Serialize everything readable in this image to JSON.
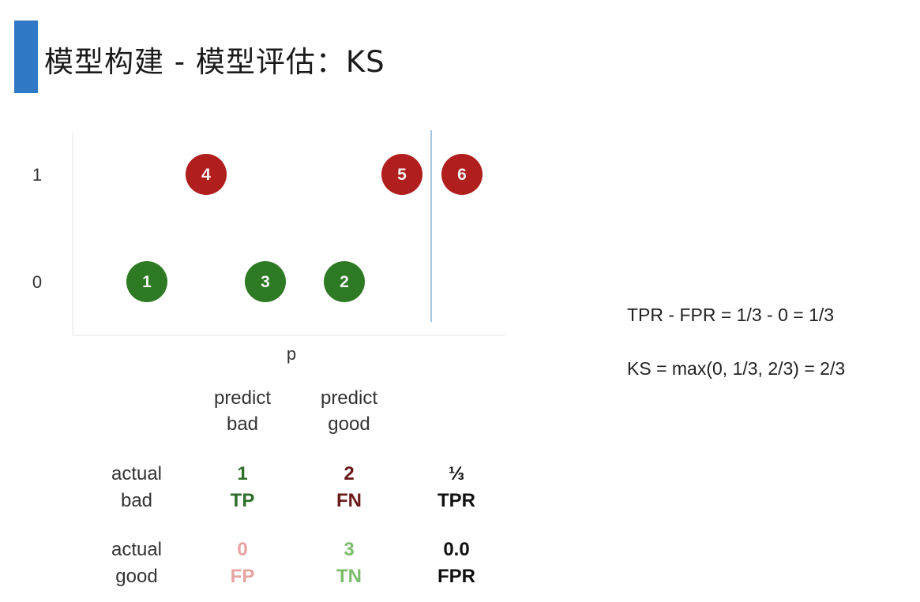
{
  "title": "模型构建 - 模型评估：KS",
  "chart_data": {
    "type": "scatter",
    "xlabel": "p",
    "ylabel": "",
    "y_ticks": [
      "1",
      "0"
    ],
    "threshold_line": true,
    "points": [
      {
        "label": "4",
        "y": 1,
        "order": 3,
        "color": "#b01e1e"
      },
      {
        "label": "5",
        "y": 1,
        "order": 6,
        "color": "#b01e1e"
      },
      {
        "label": "6",
        "y": 1,
        "order": 7,
        "color": "#b01e1e"
      },
      {
        "label": "1",
        "y": 0,
        "order": 1,
        "color": "#2e7a24"
      },
      {
        "label": "3",
        "y": 0,
        "order": 4,
        "color": "#2e7a24"
      },
      {
        "label": "2",
        "y": 0,
        "order": 5,
        "color": "#2e7a24"
      }
    ]
  },
  "confusion": {
    "col_headers": [
      {
        "line1": "predict",
        "line2": "bad"
      },
      {
        "line1": "predict",
        "line2": "good"
      }
    ],
    "rows": [
      {
        "label1": "actual",
        "label2": "bad",
        "cells": [
          {
            "value": "1",
            "name": "TP"
          },
          {
            "value": "2",
            "name": "FN"
          },
          {
            "value": "⅓",
            "name": "TPR"
          }
        ]
      },
      {
        "label1": "actual",
        "label2": "good",
        "cells": [
          {
            "value": "0",
            "name": "FP"
          },
          {
            "value": "3",
            "name": "TN"
          },
          {
            "value": "0.0",
            "name": "FPR"
          }
        ]
      }
    ]
  },
  "formulas": {
    "tpr_fpr": "TPR - FPR = 1/3 - 0 = 1/3",
    "ks": "KS = max(0, 1/3, 2/3) = 2/3"
  }
}
